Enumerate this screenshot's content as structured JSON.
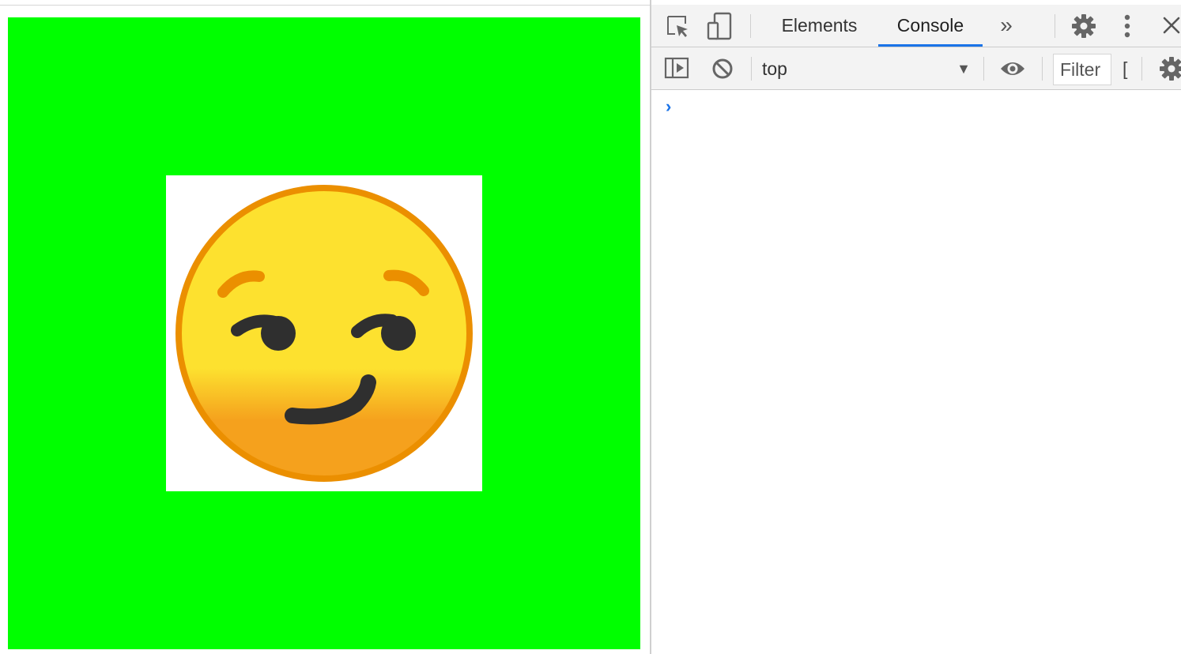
{
  "page": {
    "canvas_color": "#00ff00",
    "emoji": {
      "name": "smirking-face",
      "face_top_color": "#fde12f",
      "face_bottom_color": "#f5a11d",
      "outline_color": "#eb8f00",
      "feature_color": "#2f2f2f"
    }
  },
  "devtools": {
    "tabs": [
      {
        "label": "Elements",
        "active": false
      },
      {
        "label": "Console",
        "active": true
      }
    ],
    "more_tabs_label": "»",
    "context_select": {
      "value": "top"
    },
    "filter": {
      "placeholder": "Filter"
    },
    "console": {
      "prompt": "›"
    },
    "icons": {
      "inspect": "inspect-element-icon",
      "device": "device-toolbar-icon",
      "settings": "gear-icon",
      "menu": "vertical-dots-icon",
      "close": "close-icon",
      "sidebar": "sidebar-toggle-icon",
      "clear": "clear-console-icon",
      "eye": "live-expression-eye-icon",
      "console_settings": "console-settings-gear-icon"
    },
    "accent_color": "#1a73e8"
  }
}
